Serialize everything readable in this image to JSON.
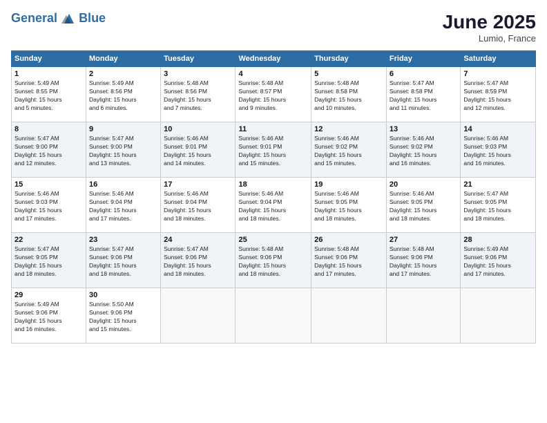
{
  "header": {
    "logo_line1": "General",
    "logo_line2": "Blue",
    "month_title": "June 2025",
    "location": "Lumio, France"
  },
  "days_of_week": [
    "Sunday",
    "Monday",
    "Tuesday",
    "Wednesday",
    "Thursday",
    "Friday",
    "Saturday"
  ],
  "weeks": [
    [
      {
        "day": "1",
        "info": "Sunrise: 5:49 AM\nSunset: 8:55 PM\nDaylight: 15 hours\nand 5 minutes."
      },
      {
        "day": "2",
        "info": "Sunrise: 5:49 AM\nSunset: 8:56 PM\nDaylight: 15 hours\nand 6 minutes."
      },
      {
        "day": "3",
        "info": "Sunrise: 5:48 AM\nSunset: 8:56 PM\nDaylight: 15 hours\nand 7 minutes."
      },
      {
        "day": "4",
        "info": "Sunrise: 5:48 AM\nSunset: 8:57 PM\nDaylight: 15 hours\nand 9 minutes."
      },
      {
        "day": "5",
        "info": "Sunrise: 5:48 AM\nSunset: 8:58 PM\nDaylight: 15 hours\nand 10 minutes."
      },
      {
        "day": "6",
        "info": "Sunrise: 5:47 AM\nSunset: 8:58 PM\nDaylight: 15 hours\nand 11 minutes."
      },
      {
        "day": "7",
        "info": "Sunrise: 5:47 AM\nSunset: 8:59 PM\nDaylight: 15 hours\nand 12 minutes."
      }
    ],
    [
      {
        "day": "8",
        "info": "Sunrise: 5:47 AM\nSunset: 9:00 PM\nDaylight: 15 hours\nand 12 minutes."
      },
      {
        "day": "9",
        "info": "Sunrise: 5:47 AM\nSunset: 9:00 PM\nDaylight: 15 hours\nand 13 minutes."
      },
      {
        "day": "10",
        "info": "Sunrise: 5:46 AM\nSunset: 9:01 PM\nDaylight: 15 hours\nand 14 minutes."
      },
      {
        "day": "11",
        "info": "Sunrise: 5:46 AM\nSunset: 9:01 PM\nDaylight: 15 hours\nand 15 minutes."
      },
      {
        "day": "12",
        "info": "Sunrise: 5:46 AM\nSunset: 9:02 PM\nDaylight: 15 hours\nand 15 minutes."
      },
      {
        "day": "13",
        "info": "Sunrise: 5:46 AM\nSunset: 9:02 PM\nDaylight: 15 hours\nand 16 minutes."
      },
      {
        "day": "14",
        "info": "Sunrise: 5:46 AM\nSunset: 9:03 PM\nDaylight: 15 hours\nand 16 minutes."
      }
    ],
    [
      {
        "day": "15",
        "info": "Sunrise: 5:46 AM\nSunset: 9:03 PM\nDaylight: 15 hours\nand 17 minutes."
      },
      {
        "day": "16",
        "info": "Sunrise: 5:46 AM\nSunset: 9:04 PM\nDaylight: 15 hours\nand 17 minutes."
      },
      {
        "day": "17",
        "info": "Sunrise: 5:46 AM\nSunset: 9:04 PM\nDaylight: 15 hours\nand 18 minutes."
      },
      {
        "day": "18",
        "info": "Sunrise: 5:46 AM\nSunset: 9:04 PM\nDaylight: 15 hours\nand 18 minutes."
      },
      {
        "day": "19",
        "info": "Sunrise: 5:46 AM\nSunset: 9:05 PM\nDaylight: 15 hours\nand 18 minutes."
      },
      {
        "day": "20",
        "info": "Sunrise: 5:46 AM\nSunset: 9:05 PM\nDaylight: 15 hours\nand 18 minutes."
      },
      {
        "day": "21",
        "info": "Sunrise: 5:47 AM\nSunset: 9:05 PM\nDaylight: 15 hours\nand 18 minutes."
      }
    ],
    [
      {
        "day": "22",
        "info": "Sunrise: 5:47 AM\nSunset: 9:05 PM\nDaylight: 15 hours\nand 18 minutes."
      },
      {
        "day": "23",
        "info": "Sunrise: 5:47 AM\nSunset: 9:06 PM\nDaylight: 15 hours\nand 18 minutes."
      },
      {
        "day": "24",
        "info": "Sunrise: 5:47 AM\nSunset: 9:06 PM\nDaylight: 15 hours\nand 18 minutes."
      },
      {
        "day": "25",
        "info": "Sunrise: 5:48 AM\nSunset: 9:06 PM\nDaylight: 15 hours\nand 18 minutes."
      },
      {
        "day": "26",
        "info": "Sunrise: 5:48 AM\nSunset: 9:06 PM\nDaylight: 15 hours\nand 17 minutes."
      },
      {
        "day": "27",
        "info": "Sunrise: 5:48 AM\nSunset: 9:06 PM\nDaylight: 15 hours\nand 17 minutes."
      },
      {
        "day": "28",
        "info": "Sunrise: 5:49 AM\nSunset: 9:06 PM\nDaylight: 15 hours\nand 17 minutes."
      }
    ],
    [
      {
        "day": "29",
        "info": "Sunrise: 5:49 AM\nSunset: 9:06 PM\nDaylight: 15 hours\nand 16 minutes."
      },
      {
        "day": "30",
        "info": "Sunrise: 5:50 AM\nSunset: 9:06 PM\nDaylight: 15 hours\nand 15 minutes."
      },
      {
        "day": "",
        "info": ""
      },
      {
        "day": "",
        "info": ""
      },
      {
        "day": "",
        "info": ""
      },
      {
        "day": "",
        "info": ""
      },
      {
        "day": "",
        "info": ""
      }
    ]
  ]
}
